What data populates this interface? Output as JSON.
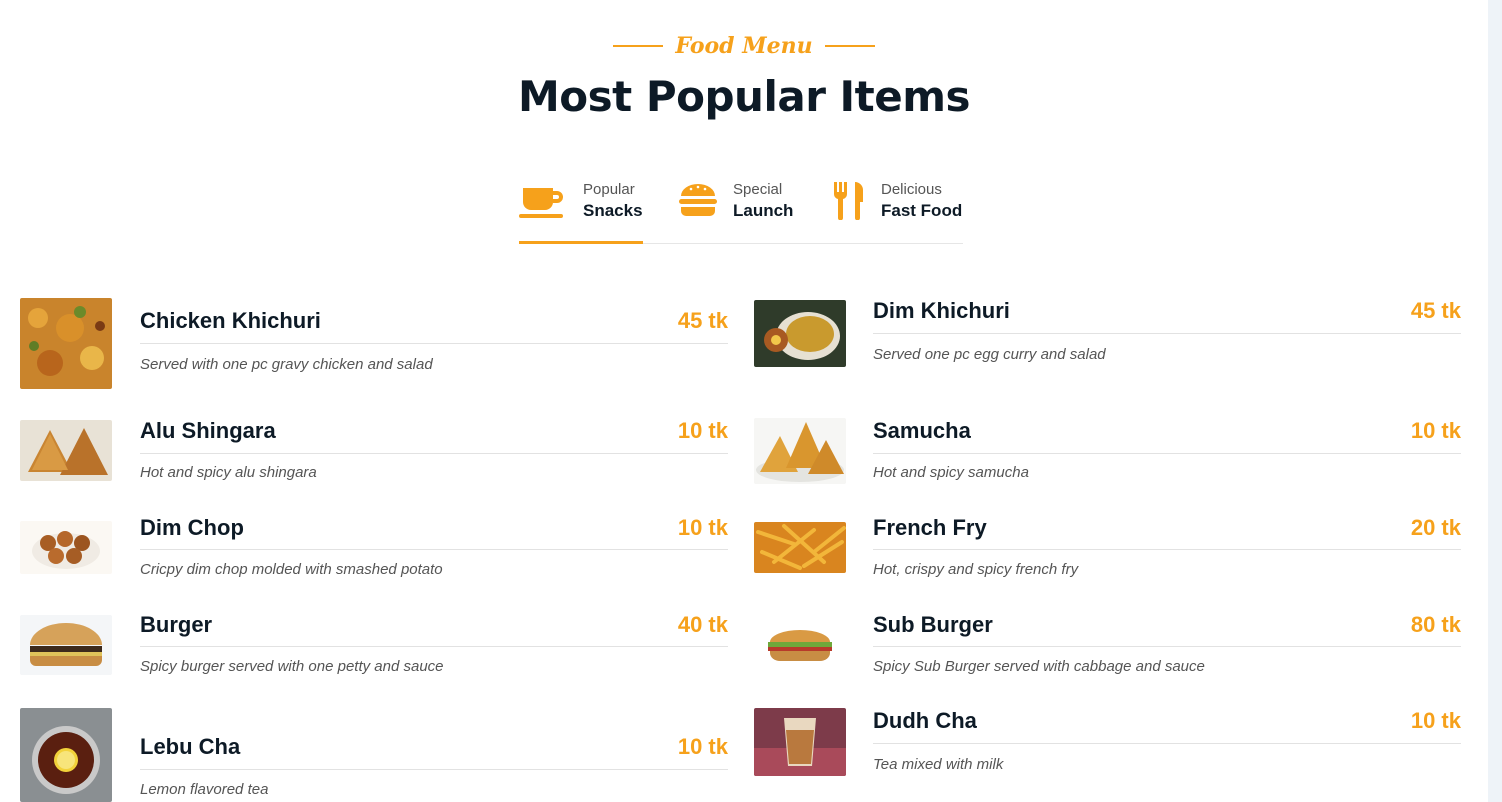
{
  "header": {
    "subtitle": "Food Menu",
    "title": "Most Popular Items"
  },
  "tabs": [
    {
      "small": "Popular",
      "big": "Snacks",
      "icon": "coffee-cup-icon",
      "active": true
    },
    {
      "small": "Special",
      "big": "Launch",
      "icon": "burger-icon",
      "active": false
    },
    {
      "small": "Delicious",
      "big": "Fast Food",
      "icon": "fork-knife-icon",
      "active": false
    }
  ],
  "colors": {
    "accent": "#f6a11b",
    "heading": "#0d1a26",
    "muted": "#555555"
  },
  "menu": {
    "left": [
      {
        "name": "Chicken Khichuri",
        "price": "45 tk",
        "desc": "Served with one pc gravy chicken and salad",
        "image": "chicken-khichuri-photo"
      },
      {
        "name": "Alu Shingara",
        "price": "10 tk",
        "desc": "Hot and spicy alu shingara",
        "image": "alu-shingara-photo"
      },
      {
        "name": "Dim Chop",
        "price": "10 tk",
        "desc": "Cricpy dim chop molded with smashed potato",
        "image": "dim-chop-photo"
      },
      {
        "name": "Burger",
        "price": "40 tk",
        "desc": "Spicy burger served with one petty and sauce",
        "image": "burger-photo"
      },
      {
        "name": "Lebu Cha",
        "price": "10 tk",
        "desc": "Lemon flavored tea",
        "image": "lebu-cha-photo"
      }
    ],
    "right": [
      {
        "name": "Dim Khichuri",
        "price": "45 tk",
        "desc": "Served one pc egg curry and salad",
        "image": "dim-khichuri-photo"
      },
      {
        "name": "Samucha",
        "price": "10 tk",
        "desc": "Hot and spicy samucha",
        "image": "samucha-photo"
      },
      {
        "name": "French Fry",
        "price": "20 tk",
        "desc": "Hot, crispy and spicy french fry",
        "image": "french-fry-photo"
      },
      {
        "name": "Sub Burger",
        "price": "80 tk",
        "desc": "Spicy Sub Burger served with cabbage and sauce",
        "image": "sub-burger-photo"
      },
      {
        "name": "Dudh Cha",
        "price": "10 tk",
        "desc": "Tea mixed with milk",
        "image": "dudh-cha-photo"
      }
    ]
  }
}
